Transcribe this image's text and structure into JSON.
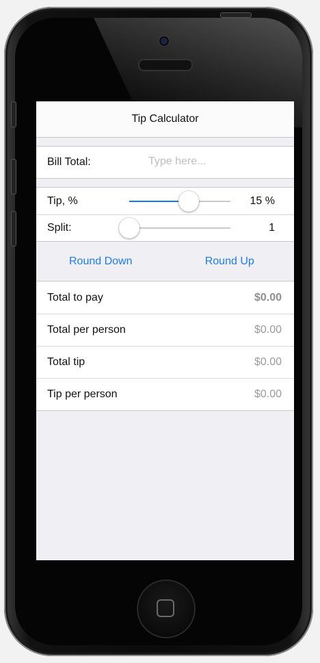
{
  "app": {
    "title": "Tip Calculator"
  },
  "bill": {
    "label": "Bill Total:",
    "placeholder": "Type here...",
    "value": ""
  },
  "tip": {
    "label": "Tip, %",
    "value_text": "15 %",
    "slider_fraction": 0.59
  },
  "split": {
    "label": "Split:",
    "value_text": "1",
    "slider_fraction": 0.0
  },
  "rounding": {
    "down_label": "Round Down",
    "up_label": "Round Up"
  },
  "results": [
    {
      "label": "Total to pay",
      "value": "$0.00"
    },
    {
      "label": "Total per person",
      "value": "$0.00"
    },
    {
      "label": "Total tip",
      "value": "$0.00"
    },
    {
      "label": "Tip per person",
      "value": "$0.00"
    }
  ],
  "colors": {
    "accent": "#1c7cf4",
    "slider_fill": "#1576e8"
  }
}
